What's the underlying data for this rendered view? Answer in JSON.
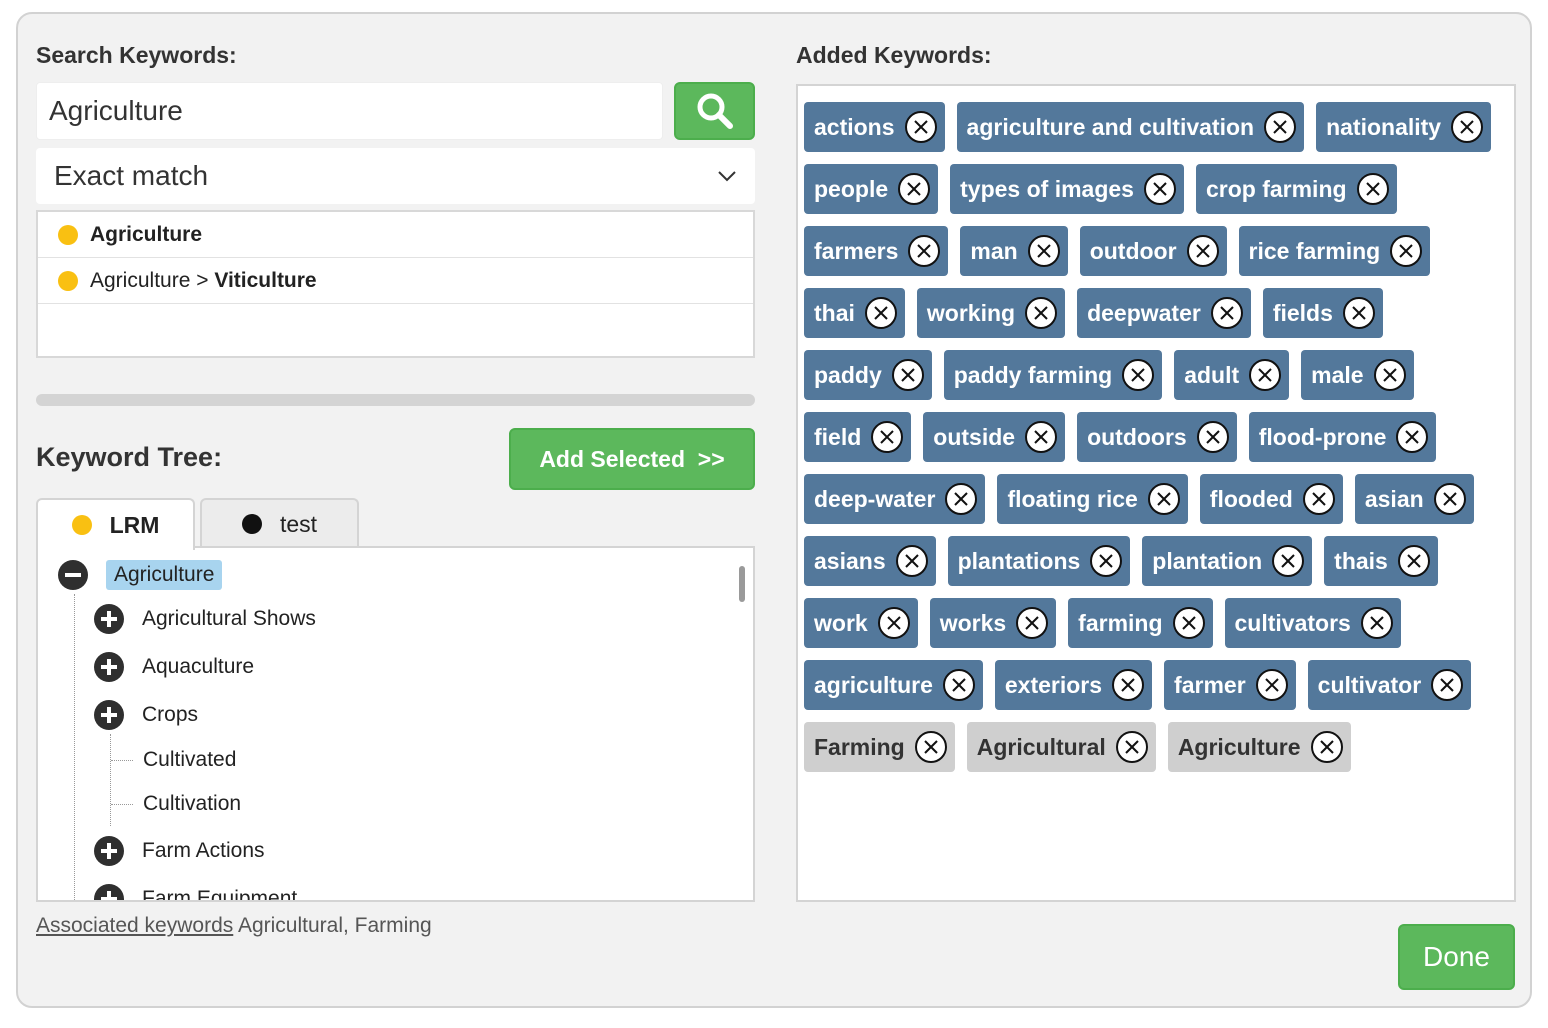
{
  "search": {
    "label": "Search Keywords:",
    "query": "Agriculture",
    "match_mode": "Exact match",
    "results": [
      {
        "prefix": "",
        "bold": "Agriculture",
        "dot": "yellow"
      },
      {
        "prefix": "Agriculture > ",
        "bold": "Viticulture",
        "dot": "yellow"
      }
    ]
  },
  "tree": {
    "label": "Keyword Tree:",
    "add_selected_label": "Add Selected  >>",
    "tabs": [
      {
        "label": "LRM",
        "dot_color": "#f9c012",
        "active": true
      },
      {
        "label": "test",
        "dot_color": "#111111",
        "active": false
      }
    ],
    "root": "Agriculture",
    "nodes": [
      {
        "label": "Agricultural Shows",
        "type": "expandable"
      },
      {
        "label": "Aquaculture",
        "type": "expandable"
      },
      {
        "label": "Crops",
        "type": "expandable"
      },
      {
        "label": "Cultivated",
        "type": "leaf"
      },
      {
        "label": "Cultivation",
        "type": "leaf"
      },
      {
        "label": "Farm Actions",
        "type": "expandable"
      },
      {
        "label": "Farm Equipment",
        "type": "expandable"
      }
    ]
  },
  "associated": {
    "link_label": "Associated keywords",
    "values": "Agricultural, Farming"
  },
  "added": {
    "label": "Added Keywords:",
    "tags": [
      {
        "text": "actions",
        "style": "blue"
      },
      {
        "text": "agriculture and cultivation",
        "style": "blue"
      },
      {
        "text": "nationality",
        "style": "blue"
      },
      {
        "text": "people",
        "style": "blue"
      },
      {
        "text": "types of images",
        "style": "blue"
      },
      {
        "text": "crop farming",
        "style": "blue"
      },
      {
        "text": "farmers",
        "style": "blue"
      },
      {
        "text": "man",
        "style": "blue"
      },
      {
        "text": "outdoor",
        "style": "blue"
      },
      {
        "text": "rice farming",
        "style": "blue"
      },
      {
        "text": "thai",
        "style": "blue"
      },
      {
        "text": "working",
        "style": "blue"
      },
      {
        "text": "deepwater",
        "style": "blue"
      },
      {
        "text": "fields",
        "style": "blue"
      },
      {
        "text": "paddy",
        "style": "blue"
      },
      {
        "text": "paddy farming",
        "style": "blue"
      },
      {
        "text": "adult",
        "style": "blue"
      },
      {
        "text": "male",
        "style": "blue"
      },
      {
        "text": "field",
        "style": "blue"
      },
      {
        "text": "outside",
        "style": "blue"
      },
      {
        "text": "outdoors",
        "style": "blue"
      },
      {
        "text": "flood-prone",
        "style": "blue"
      },
      {
        "text": "deep-water",
        "style": "blue"
      },
      {
        "text": "floating rice",
        "style": "blue"
      },
      {
        "text": "flooded",
        "style": "blue"
      },
      {
        "text": "asian",
        "style": "blue"
      },
      {
        "text": "asians",
        "style": "blue"
      },
      {
        "text": "plantations",
        "style": "blue"
      },
      {
        "text": "plantation",
        "style": "blue"
      },
      {
        "text": "thais",
        "style": "blue"
      },
      {
        "text": "work",
        "style": "blue"
      },
      {
        "text": "works",
        "style": "blue"
      },
      {
        "text": "farming",
        "style": "blue"
      },
      {
        "text": "cultivators",
        "style": "blue"
      },
      {
        "text": "agriculture",
        "style": "blue"
      },
      {
        "text": "exteriors",
        "style": "blue"
      },
      {
        "text": "farmer",
        "style": "blue"
      },
      {
        "text": "cultivator",
        "style": "blue"
      },
      {
        "text": "Farming",
        "style": "grey"
      },
      {
        "text": "Agricultural",
        "style": "grey"
      },
      {
        "text": "Agriculture",
        "style": "grey"
      }
    ]
  },
  "done_label": "Done",
  "colors": {
    "accent_green": "#5cb85c",
    "tag_blue": "#53789b",
    "tag_grey": "#cfcfcf",
    "dot_yellow": "#f9c012",
    "selected_node": "#a8d4ef"
  }
}
